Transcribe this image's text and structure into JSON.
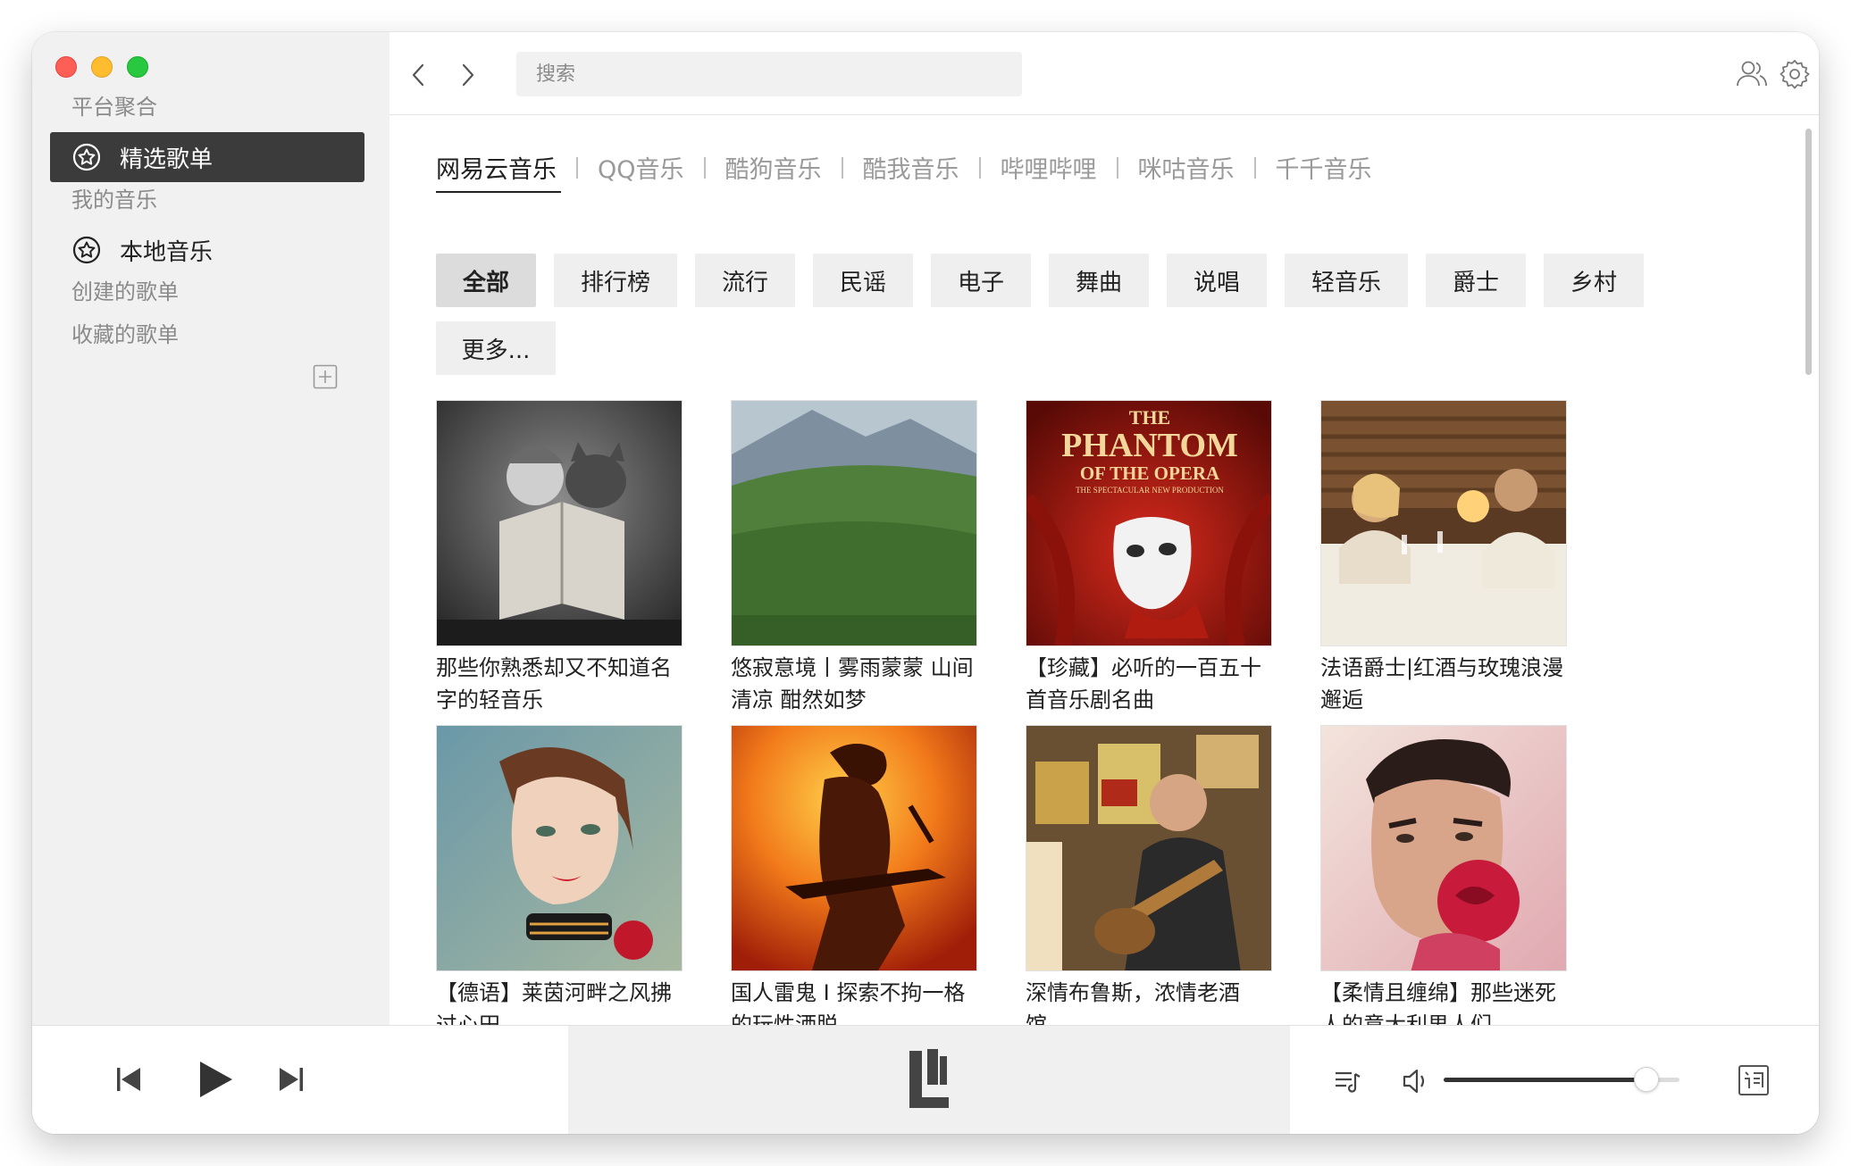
{
  "sidebar": {
    "section_platform": "平台聚合",
    "item_featured": "精选歌单",
    "section_my_music": "我的音乐",
    "item_local": "本地音乐",
    "item_created": "创建的歌单",
    "item_favorited": "收藏的歌单"
  },
  "topbar": {
    "search_placeholder": "搜索",
    "icons": [
      "chevron-left-icon",
      "chevron-right-icon",
      "users-icon",
      "gear-icon"
    ]
  },
  "tabs": [
    "网易云音乐",
    "QQ音乐",
    "酷狗音乐",
    "酷我音乐",
    "哔哩哔哩",
    "咪咕音乐",
    "千千音乐"
  ],
  "active_tab": 0,
  "categories": [
    "全部",
    "排行榜",
    "流行",
    "民谣",
    "电子",
    "舞曲",
    "说唱",
    "轻音乐",
    "爵士",
    "乡村",
    "更多..."
  ],
  "active_category": 0,
  "playlists": [
    {
      "title": "那些你熟悉却又不知道名字的轻音乐"
    },
    {
      "title": "悠寂意境丨雾雨蒙蒙 山间清凉 酣然如梦"
    },
    {
      "title": "【珍藏】必听的一百五十首音乐剧名曲"
    },
    {
      "title": "法语爵士|红酒与玫瑰浪漫邂逅"
    },
    {
      "title": "【德语】莱茵河畔之风拂过心田"
    },
    {
      "title": "国人雷鬼 I 探索不拘一格的玩性洒脱"
    },
    {
      "title": "深情布鲁斯，浓情老酒馆。"
    },
    {
      "title": "【柔情且缠绵】那些迷死人的意大利男人们"
    }
  ],
  "cover_art": {
    "phantom_line1": "THE",
    "phantom_line2": "PHANTOM",
    "phantom_line3": "OF THE OPERA",
    "phantom_line4": "THE SPECTACULAR NEW PRODUCTION"
  },
  "player": {
    "volume": 0.86,
    "icons": [
      "skip-previous-icon",
      "play-icon",
      "skip-next-icon",
      "playlist-icon",
      "volume-icon",
      "lyrics-icon"
    ]
  },
  "colors": {
    "active_bg": "#3b3b3b",
    "sidebar_bg": "#f1f1f1",
    "chip_bg": "#efefef"
  }
}
